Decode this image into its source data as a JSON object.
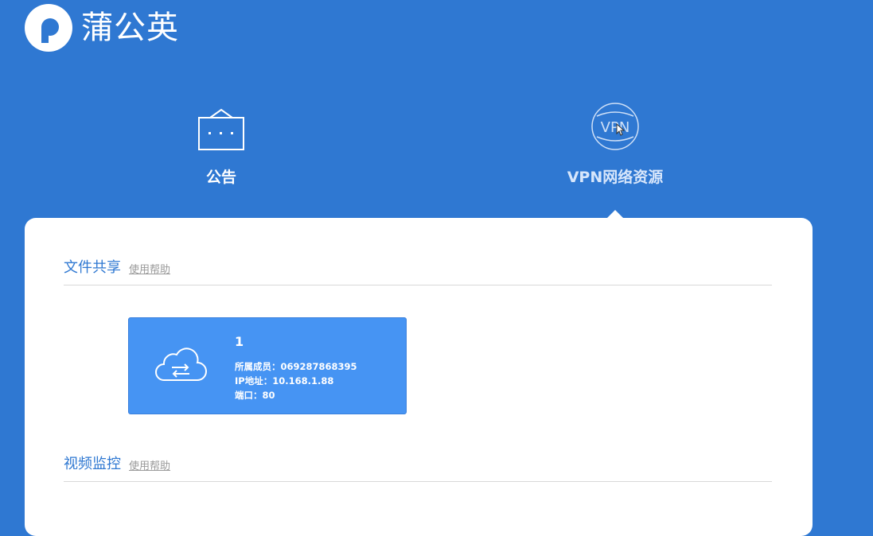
{
  "brand": {
    "name": "蒲公英"
  },
  "tabs": [
    {
      "label": "公告",
      "icon": "announcement-icon"
    },
    {
      "label": "VPN网络资源",
      "icon": "vpn-icon",
      "icon_text": "VPN",
      "active": true
    }
  ],
  "sections": {
    "file_share": {
      "title": "文件共享",
      "help": "使用帮助"
    },
    "video_monitor": {
      "title": "视频监控",
      "help": "使用帮助"
    }
  },
  "resource_card": {
    "name": "1",
    "member_label": "所属成员：",
    "member": "069287868395",
    "ip_label": "IP地址：",
    "ip": "10.168.1.88",
    "port_label": "端口：",
    "port": "80",
    "icon": "cloud-transfer-icon"
  },
  "colors": {
    "background": "#2f78d2",
    "card": "#4694f3",
    "title": "#2f78d2"
  }
}
